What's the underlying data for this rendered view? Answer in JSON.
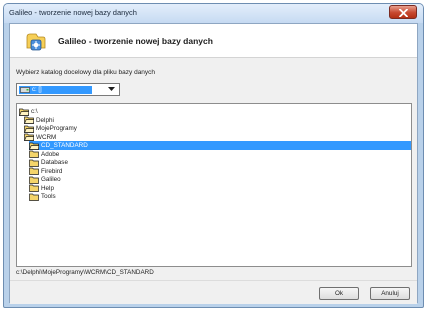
{
  "window": {
    "title": "Galileo - tworzenie nowej bazy danych"
  },
  "header": {
    "title": "Galileo - tworzenie nowej bazy danych"
  },
  "prompt": "Wybierz katalog docelowy dla pliku bazy danych",
  "drive": {
    "selected": "c: []"
  },
  "tree": [
    {
      "label": "c:\\",
      "selected": false
    },
    {
      "label": "Delphi",
      "selected": false
    },
    {
      "label": "MojeProgramy",
      "selected": false
    },
    {
      "label": "WCRM",
      "selected": false
    },
    {
      "label": "CD_STANDARD",
      "selected": true
    },
    {
      "label": "Adobe",
      "selected": false
    },
    {
      "label": "Database",
      "selected": false
    },
    {
      "label": "Firebird",
      "selected": false
    },
    {
      "label": "Galileo",
      "selected": false
    },
    {
      "label": "Help",
      "selected": false
    },
    {
      "label": "Tools",
      "selected": false
    }
  ],
  "selected_path": "c:\\Delphi\\MojeProgramy\\WCRM\\CD_STANDARD",
  "buttons": {
    "ok": "Ok",
    "cancel": "Anuluj"
  },
  "colors": {
    "selection": "#3399ff",
    "folder": "#f5d56a"
  }
}
